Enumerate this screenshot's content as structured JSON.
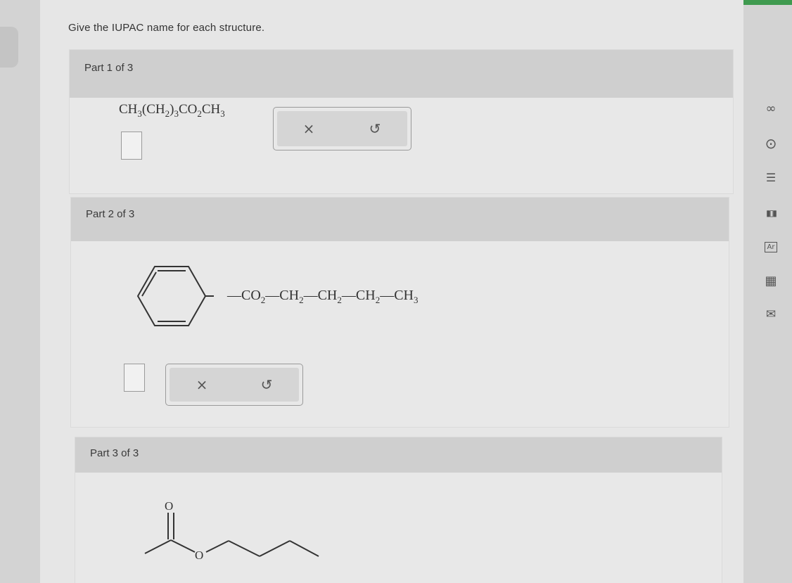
{
  "instruction": "Give the IUPAC name for each structure.",
  "parts": [
    {
      "label": "Part 1 of 3",
      "formula": {
        "t1": "CH",
        "s1": "3",
        "t2": "(CH",
        "s2": "2",
        "t3": ")",
        "s3": "3",
        "t4": "CO",
        "s4": "2",
        "t5": "CH",
        "s5": "3"
      },
      "clear_icon": "×",
      "undo_icon": "↺"
    },
    {
      "label": "Part 2 of 3",
      "chain": {
        "co": "CO",
        "sco": "2",
        "ch": "CH",
        "s2": "2",
        "s3": "3",
        "dash": "—"
      },
      "clear_icon": "×",
      "undo_icon": "↺"
    },
    {
      "label": "Part 3 of 3",
      "carbonyl_o": "O",
      "ester_o": "O"
    }
  ],
  "toolbar": {
    "link_icon": "∞",
    "arrow_icon": "⊙",
    "notes_icon": "☰",
    "chart_icon": "▮▯▮",
    "font_icon": "Ar",
    "calc_icon": "▦",
    "mail_icon": "✉"
  }
}
